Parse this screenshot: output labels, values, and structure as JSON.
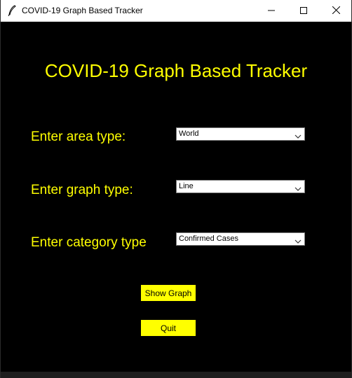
{
  "window": {
    "title": "COVID-19 Graph Based Tracker"
  },
  "main": {
    "heading": "COVID-19 Graph Based Tracker",
    "area": {
      "label": "Enter area type:",
      "selected": "World"
    },
    "graph": {
      "label": "Enter graph type:",
      "selected": "Line"
    },
    "category": {
      "label": "Enter category type",
      "selected": "Confirmed Cases"
    },
    "show_graph_label": "Show Graph",
    "quit_label": "Quit"
  },
  "colors": {
    "background": "#000000",
    "accent": "#ffff00",
    "titlebar": "#ffffff"
  },
  "icons": {
    "app": "feather-icon",
    "minimize": "minimize-icon",
    "maximize": "maximize-icon",
    "close": "close-icon",
    "dropdown": "chevron-down-icon"
  }
}
